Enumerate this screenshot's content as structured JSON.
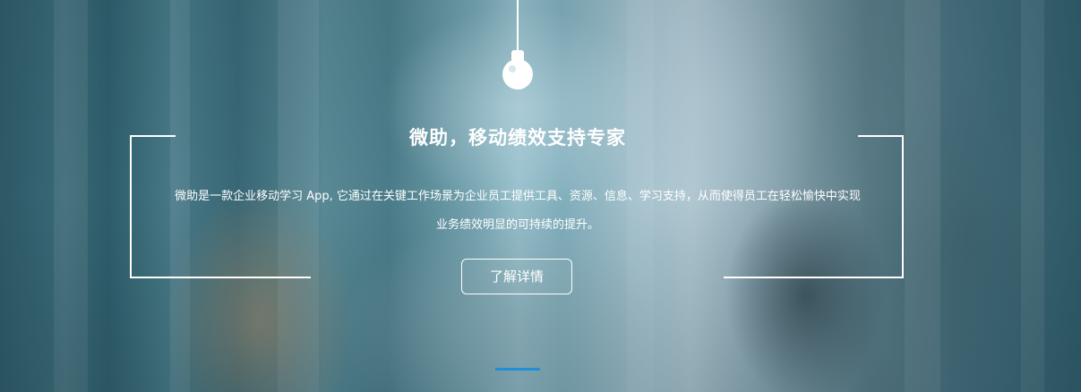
{
  "hero": {
    "title": "微助，移动绩效支持专家",
    "description": "微助是一款企业移动学习 App, 它通过在关键工作场景为企业员工提供工具、资源、信息、学习支持，从而使得员工在轻松愉快中实现业务绩效明显的可持续的提升。",
    "button_label": "了解详情",
    "decor_icon": "pendant-lamp-icon"
  },
  "carousel": {
    "indicator_color": "#1e8fd8"
  },
  "colors": {
    "text": "#ffffff",
    "accent": "#1e8fd8"
  }
}
